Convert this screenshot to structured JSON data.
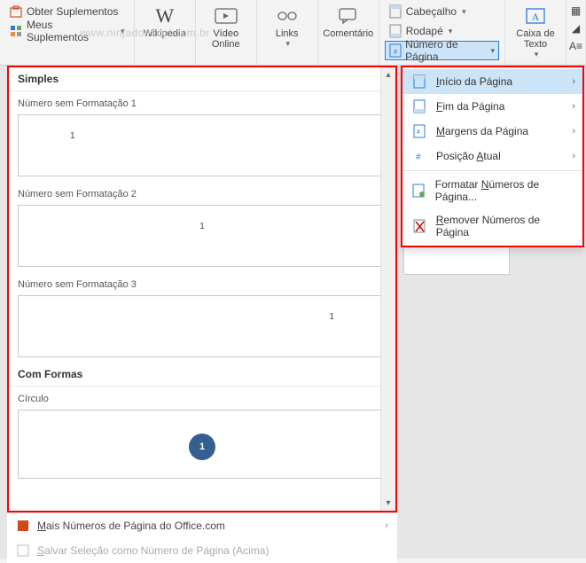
{
  "watermark": "www.ninjadoexcel.com.br",
  "ribbon": {
    "obter_suplementos": "Obter Suplementos",
    "meus_suplementos": "Meus Suplementos",
    "wikipedia": "Wikipedia",
    "video_online": "Vídeo Online",
    "links": "Links",
    "comentario": "Comentário",
    "cabecalho": "Cabeçalho",
    "rodape": "Rodapé",
    "numero_pagina": "Número de Página",
    "caixa_texto": "Caixa de Texto"
  },
  "submenu": {
    "inicio": "nício da Página",
    "fim": "im da Página",
    "margens": "argens da Página",
    "posicao": "Posição ",
    "posicao_suffix": "tual",
    "formatar": "Formatar ",
    "formatar_suffix": "úmeros de Página...",
    "remover": "emover Números de Página"
  },
  "gallery": {
    "cat1": "Simples",
    "item1": "Número sem Formatação 1",
    "item2": "Número sem Formatação 2",
    "item3": "Número sem Formatação 3",
    "cat2": "Com Formas",
    "item4": "Círculo",
    "page_number": "1"
  },
  "footer": {
    "mais": "ais Números de Página do Office.com",
    "salvar": "alvar Seleção como Número de Página (Acima)"
  }
}
